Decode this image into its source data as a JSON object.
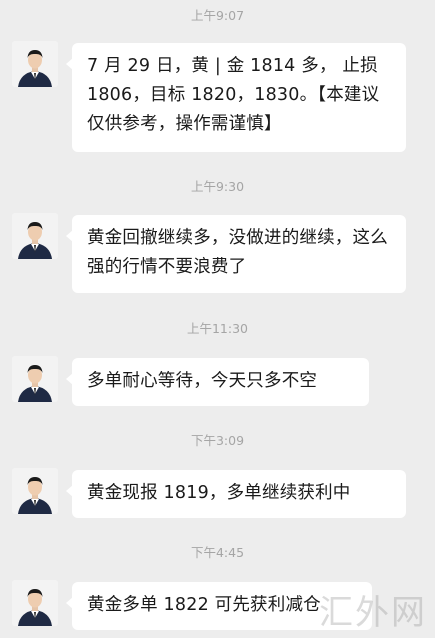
{
  "messages": [
    {
      "time": "上午9:07",
      "text": "7 月 29 日，黄 | 金 1814 多， 止损 1806，目标 1820，1830。【本建议仅供参考，操作需谨慎】"
    },
    {
      "time": "上午9:30",
      "text": "黄金回撤继续多，没做进的继续，这么强的行情不要浪费了"
    },
    {
      "time": "上午11:30",
      "text": "多单耐心等待，今天只多不空"
    },
    {
      "time": "下午3:09",
      "text": "黄金现报 1819，多单继续获利中"
    },
    {
      "time": "下午4:45",
      "text": "黄金多单 1822 可先获利减仓"
    }
  ],
  "watermark": "汇外网",
  "colors": {
    "background": "#ededed",
    "bubble": "#ffffff",
    "timestamp": "#a5a5a5"
  },
  "icons": {
    "avatar": "avatar-icon"
  }
}
